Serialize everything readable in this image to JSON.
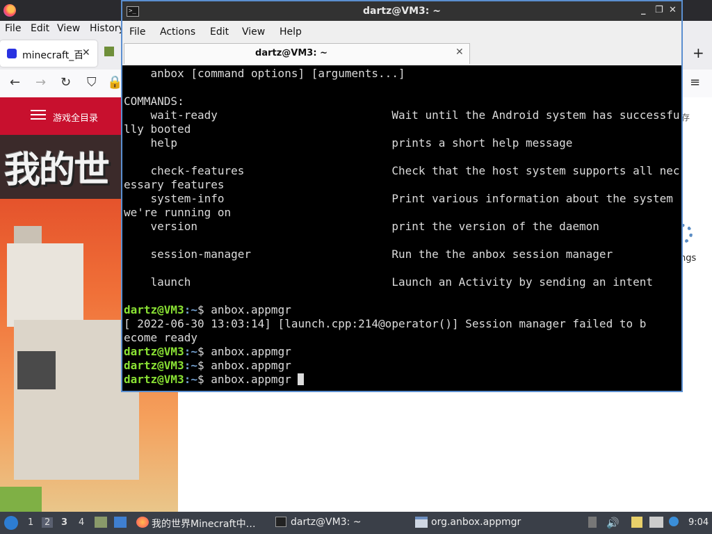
{
  "firefox": {
    "menu": [
      "File",
      "Edit",
      "View",
      "History"
    ],
    "tab_title": "minecraft_百",
    "tab_close": "✕",
    "new_tab": "+",
    "page": {
      "category_label": "游戏全目录",
      "banner_text": "我的世",
      "search_hint": "存",
      "settings_label": "ngs"
    }
  },
  "terminal": {
    "window_title": "dartz@VM3: ~",
    "window_buttons": [
      "_",
      "❐",
      "✕"
    ],
    "menu": [
      "File",
      "Actions",
      "Edit",
      "View",
      "Help"
    ],
    "tab_label": "dartz@VM3: ~",
    "tab_close": "✕",
    "lines": [
      "    anbox [command options] [arguments...]",
      "",
      "COMMANDS:",
      "    wait-ready                          Wait until the Android system has successfu",
      "lly booted",
      "    help                                prints a short help message",
      "",
      "    check-features                      Check that the host system supports all nec",
      "essary features",
      "    system-info                         Print various information about the system ",
      "we're running on",
      "    version                             print the version of the daemon",
      "",
      "    session-manager                     Run the the anbox session manager",
      "",
      "    launch                              Launch an Activity by sending an intent",
      ""
    ],
    "prompt_user": "dartz@VM3",
    "prompt_path": ":~",
    "prompt_sign": "$ ",
    "cmd1": "anbox.appmgr",
    "error_line1": "[ 2022-06-30 13:03:14] [launch.cpp:214@operator()] Session manager failed to b",
    "error_line2": "ecome ready",
    "cmd2": "anbox.appmgr",
    "cmd3": "anbox.appmgr",
    "cmd4": "anbox.appmgr "
  },
  "taskbar": {
    "workspaces": [
      "1",
      "2",
      "3",
      "4"
    ],
    "tasks": [
      "我的世界Minecraft中…",
      "dartz@VM3: ~",
      "org.anbox.appmgr"
    ],
    "clock": "9:04"
  },
  "colors": {
    "prompt_user": "#8ae234",
    "prompt_path": "#729fcf",
    "terminal_border": "#5b8fd0",
    "category_bar": "#c8102e"
  }
}
